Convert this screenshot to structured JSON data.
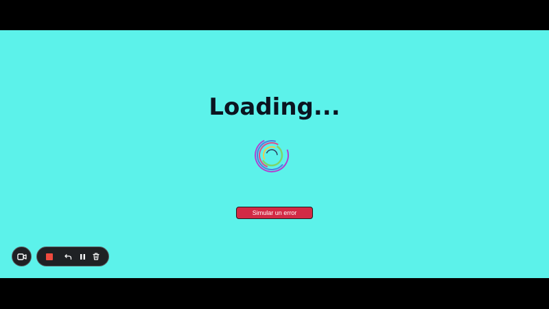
{
  "page": {
    "background": "#5cf2ea",
    "letterbox_color": "#000000",
    "title": "Loading..."
  },
  "spinner": {
    "icon": "loading-spinner-icon",
    "colors": [
      "#b13fd0",
      "#4a7de0",
      "#e24a8a",
      "#7ed56b",
      "#f2c94c",
      "#2a3a5a"
    ]
  },
  "error_button": {
    "label": "Simular un error",
    "background": "#d22a45"
  },
  "recorder": {
    "camera": {
      "icon": "video-camera-icon"
    },
    "stop": {
      "icon": "stop-icon",
      "color": "#f04a3e"
    },
    "undo": {
      "icon": "undo-icon"
    },
    "pause": {
      "icon": "pause-icon"
    },
    "delete": {
      "icon": "trash-icon"
    }
  }
}
